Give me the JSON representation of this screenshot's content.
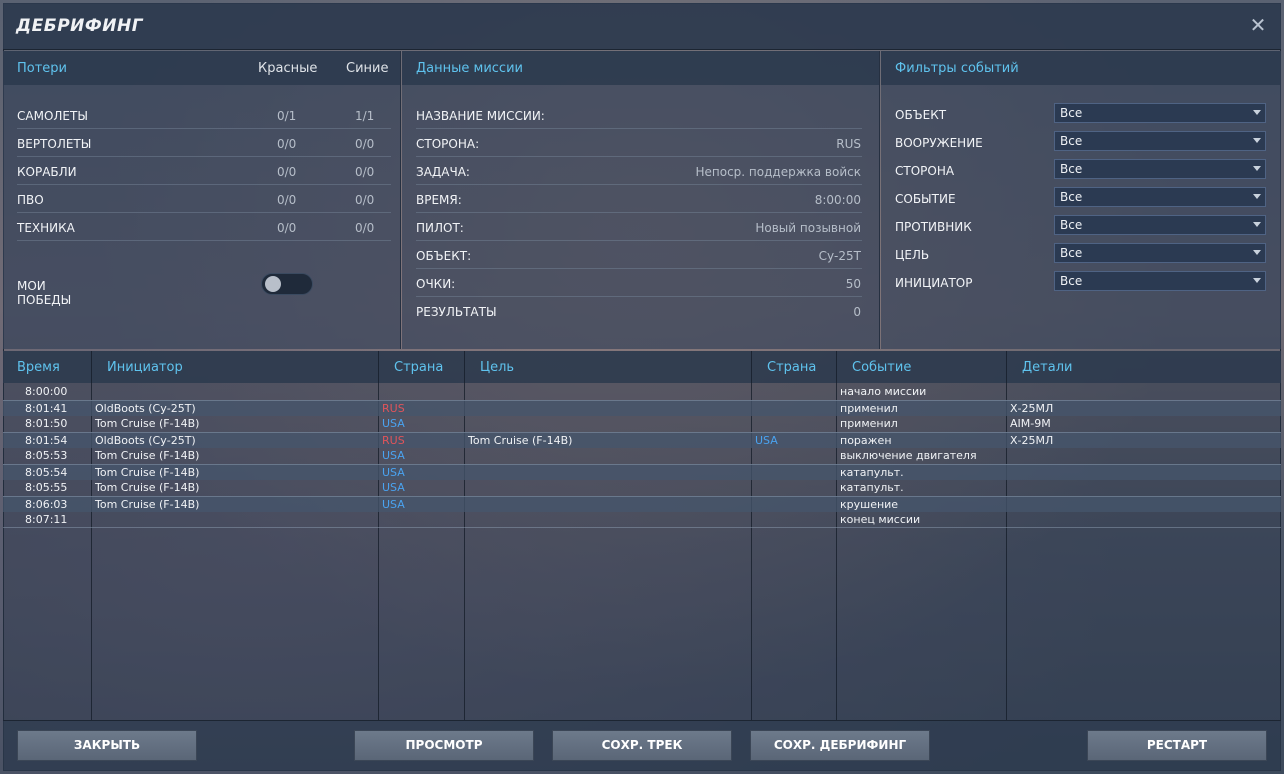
{
  "title": "ДЕБРИФИНГ",
  "close_glyph": "✕",
  "losses": {
    "header": "Потери",
    "col_red": "Красные",
    "col_blue": "Синие",
    "rows": [
      {
        "label": "САМОЛЕТЫ",
        "red": "0/1",
        "blue": "1/1"
      },
      {
        "label": "ВЕРТОЛЕТЫ",
        "red": "0/0",
        "blue": "0/0"
      },
      {
        "label": "КОРАБЛИ",
        "red": "0/0",
        "blue": "0/0"
      },
      {
        "label": "ПВО",
        "red": "0/0",
        "blue": "0/0"
      },
      {
        "label": "ТЕХНИКА",
        "red": "0/0",
        "blue": "0/0"
      }
    ],
    "my_wins_label": "МОИ ПОБЕДЫ",
    "my_wins_on": false
  },
  "mission": {
    "header": "Данные миссии",
    "rows": [
      {
        "label": "НАЗВАНИЕ МИССИИ:",
        "value": ""
      },
      {
        "label": "СТОРОНА:",
        "value": "RUS"
      },
      {
        "label": "ЗАДАЧА:",
        "value": "Непоср. поддержка войск"
      },
      {
        "label": "ВРЕМЯ:",
        "value": "8:00:00"
      },
      {
        "label": "ПИЛОТ:",
        "value": "Новый позывной"
      },
      {
        "label": "ОБЪЕКТ:",
        "value": "Су-25Т"
      },
      {
        "label": "ОЧКИ:",
        "value": "50"
      },
      {
        "label": "РЕЗУЛЬТАТЫ",
        "value": "0"
      }
    ]
  },
  "filters": {
    "header": "Фильтры событий",
    "rows": [
      {
        "label": "ОБЪЕКТ",
        "value": "Все"
      },
      {
        "label": "ВООРУЖЕНИЕ",
        "value": "Все"
      },
      {
        "label": "СТОРОНА",
        "value": "Все"
      },
      {
        "label": "СОБЫТИЕ",
        "value": "Все"
      },
      {
        "label": "ПРОТИВНИК",
        "value": "Все"
      },
      {
        "label": "ЦЕЛЬ",
        "value": "Все"
      },
      {
        "label": "ИНИЦИАТОР",
        "value": "Все"
      }
    ]
  },
  "events": {
    "columns": [
      "Время",
      "Инициатор",
      "Страна",
      "Цель",
      "Страна",
      "Событие",
      "Детали"
    ],
    "rows": [
      {
        "time": "8:00:00",
        "initiator": "",
        "country": "",
        "target": "",
        "target_country": "",
        "event": "начало миссии",
        "details": ""
      },
      {
        "time": "8:01:41",
        "initiator": "OldBoots (Су-25Т)",
        "country": "RUS",
        "target": "",
        "target_country": "",
        "event": "применил",
        "details": "Х-25МЛ"
      },
      {
        "time": "8:01:50",
        "initiator": "Tom Cruise (F-14B)",
        "country": "USA",
        "target": "",
        "target_country": "",
        "event": "применил",
        "details": "AIM-9M"
      },
      {
        "time": "8:01:54",
        "initiator": "OldBoots (Су-25Т)",
        "country": "RUS",
        "target": "Tom Cruise (F-14B)",
        "target_country": "USA",
        "event": "поражен",
        "details": "Х-25МЛ"
      },
      {
        "time": "8:05:53",
        "initiator": "Tom Cruise (F-14B)",
        "country": "USA",
        "target": "",
        "target_country": "",
        "event": "выключение двигателя",
        "details": ""
      },
      {
        "time": "8:05:54",
        "initiator": "Tom Cruise (F-14B)",
        "country": "USA",
        "target": "",
        "target_country": "",
        "event": "катапульт.",
        "details": ""
      },
      {
        "time": "8:05:55",
        "initiator": "Tom Cruise (F-14B)",
        "country": "USA",
        "target": "",
        "target_country": "",
        "event": "катапульт.",
        "details": ""
      },
      {
        "time": "8:06:03",
        "initiator": "Tom Cruise (F-14B)",
        "country": "USA",
        "target": "",
        "target_country": "",
        "event": "крушение",
        "details": ""
      },
      {
        "time": "8:07:11",
        "initiator": "",
        "country": "",
        "target": "",
        "target_country": "",
        "event": "конец миссии",
        "details": ""
      }
    ]
  },
  "buttons": {
    "close": "ЗАКРЫТЬ",
    "view": "ПРОСМОТР",
    "save_track": "СОХР. ТРЕК",
    "save_debrief": "СОХР. ДЕБРИФИНГ",
    "restart": "РЕСТАРТ"
  },
  "colors": {
    "accent": "#5fc3ee",
    "rus": "#e0545a",
    "usa": "#4aa3f0"
  }
}
